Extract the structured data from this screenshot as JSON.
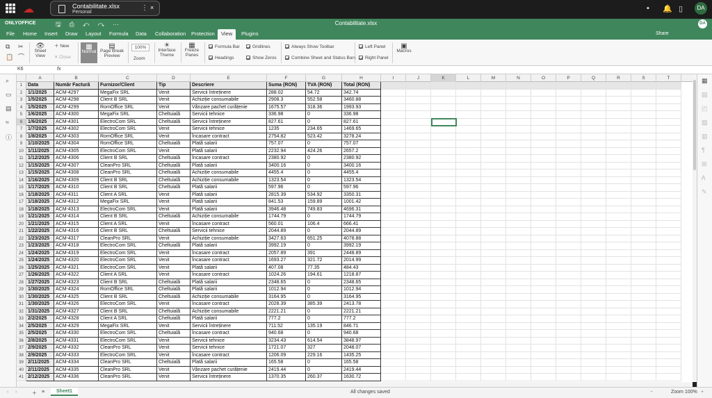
{
  "topbar": {
    "file_name": "Contabilitate.xlsx",
    "location": "Personal",
    "more": "⋮",
    "close": "×",
    "avatar": "DA"
  },
  "header": {
    "logo": "ONLYOFFICE",
    "title": "Contabilitate.xlsx",
    "avatar": "DA",
    "share": "Share"
  },
  "menu": [
    "File",
    "Home",
    "Insert",
    "Draw",
    "Layout",
    "Formula",
    "Data",
    "Collaboration",
    "Protection",
    "View",
    "Plugins"
  ],
  "menu_active": "View",
  "toolbar": {
    "sheet_view": "Sheet View",
    "new": "New",
    "close": "Close",
    "normal": "Normal",
    "page_break": "Page Break Preview",
    "zoom_value": "100%",
    "zoom": "Zoom",
    "interface_theme": "Interface Theme",
    "freeze_panes": "Freeze Panes",
    "formula_bar": "Formula Bar",
    "headings": "Headings",
    "gridlines": "Gridlines",
    "show_zeros": "Show Zeros",
    "always_show_toolbar": "Always Show Toolbar",
    "combine_sheet": "Combine Sheet and Status Bars",
    "left_panel": "Left Panel",
    "right_panel": "Right Panel",
    "macros": "Macros"
  },
  "formula": {
    "name_box": "K6",
    "fx": "fx",
    "value": ""
  },
  "columns": [
    "A",
    "B",
    "C",
    "D",
    "E",
    "F",
    "G",
    "H",
    "I",
    "J",
    "K",
    "L",
    "M",
    "N",
    "O",
    "P",
    "Q",
    "R",
    "S",
    "T"
  ],
  "table_header": [
    "Data",
    "Număr Factură",
    "Furnizor/Client",
    "Tip",
    "Descriere",
    "Suma (RON)",
    "TVA (RON)",
    "Total (RON)"
  ],
  "rows": [
    [
      "1/1/2025",
      "ACM-4297",
      "MegaFix SRL",
      "Venit",
      "Servicii întreținere",
      "288.02",
      "54.72",
      "342.74"
    ],
    [
      "1/5/2025",
      "ACM-4298",
      "Client B SRL",
      "Venit",
      "Achiziție consumabile",
      "2908.3",
      "552.58",
      "3460.88"
    ],
    [
      "1/5/2025",
      "ACM-4299",
      "RomOffice SRL",
      "Venit",
      "Vânzare pachet curățenie",
      "1675.57",
      "318.36",
      "1993.93"
    ],
    [
      "1/6/2025",
      "ACM-4300",
      "MegaFix SRL",
      "Cheltuială",
      "Servicii tehnice",
      "336.98",
      "0",
      "336.98"
    ],
    [
      "1/6/2025",
      "ACM-4301",
      "ElectroCom SRL",
      "Cheltuială",
      "Servicii întreținere",
      "827.61",
      "0",
      "827.61"
    ],
    [
      "1/7/2025",
      "ACM-4302",
      "ElectroCom SRL",
      "Venit",
      "Servicii tehnice",
      "1235",
      "234.65",
      "1469.65"
    ],
    [
      "1/8/2025",
      "ACM-4303",
      "RomOffice SRL",
      "Venit",
      "Încasare contract",
      "2754.82",
      "523.42",
      "3278.24"
    ],
    [
      "1/10/2025",
      "ACM-4304",
      "RomOffice SRL",
      "Cheltuială",
      "Plată salarii",
      "757.07",
      "0",
      "757.07"
    ],
    [
      "1/11/2025",
      "ACM-4305",
      "ElectroCom SRL",
      "Venit",
      "Plată salarii",
      "2232.94",
      "424.26",
      "2657.2"
    ],
    [
      "1/12/2025",
      "ACM-4306",
      "Client B SRL",
      "Cheltuială",
      "Încasare contract",
      "2380.92",
      "0",
      "2380.92"
    ],
    [
      "1/15/2025",
      "ACM-4307",
      "CleanPro SRL",
      "Cheltuială",
      "Plată salarii",
      "3400.16",
      "0",
      "3400.16"
    ],
    [
      "1/15/2025",
      "ACM-4308",
      "CleanPro SRL",
      "Cheltuială",
      "Achiziție consumabile",
      "4455.4",
      "0",
      "4455.4"
    ],
    [
      "1/16/2025",
      "ACM-4309",
      "Client B SRL",
      "Cheltuială",
      "Achiziție consumabile",
      "1323.54",
      "0",
      "1323.54"
    ],
    [
      "1/17/2025",
      "ACM-4310",
      "Client B SRL",
      "Cheltuială",
      "Plată salarii",
      "597.96",
      "0",
      "597.96"
    ],
    [
      "1/18/2025",
      "ACM-4311",
      "Client A SRL",
      "Venit",
      "Plată salarii",
      "2815.39",
      "534.92",
      "3350.31"
    ],
    [
      "1/18/2025",
      "ACM-4312",
      "MegaFix SRL",
      "Venit",
      "Plată salarii",
      "841.53",
      "159.89",
      "1001.42"
    ],
    [
      "1/18/2025",
      "ACM-4313",
      "ElectroCom SRL",
      "Venit",
      "Plată salarii",
      "3946.48",
      "749.83",
      "4696.31"
    ],
    [
      "1/21/2025",
      "ACM-4314",
      "Client B SRL",
      "Cheltuială",
      "Achiziție consumabile",
      "1744.79",
      "0",
      "1744.79"
    ],
    [
      "1/21/2025",
      "ACM-4315",
      "Client A SRL",
      "Venit",
      "Încasare contract",
      "560.01",
      "106.4",
      "666.41"
    ],
    [
      "1/22/2025",
      "ACM-4316",
      "Client B SRL",
      "Cheltuială",
      "Servicii tehnice",
      "2044.89",
      "0",
      "2044.89"
    ],
    [
      "1/23/2025",
      "ACM-4317",
      "CleanPro SRL",
      "Venit",
      "Achiziție consumabile",
      "3427.63",
      "651.25",
      "4078.88"
    ],
    [
      "1/23/2025",
      "ACM-4318",
      "ElectroCom SRL",
      "Cheltuială",
      "Plată salarii",
      "3992.19",
      "0",
      "3992.19"
    ],
    [
      "1/24/2025",
      "ACM-4319",
      "ElectroCom SRL",
      "Venit",
      "Încasare contract",
      "2057.89",
      "391",
      "2448.89"
    ],
    [
      "1/24/2025",
      "ACM-4320",
      "ElectroCom SRL",
      "Venit",
      "Încasare contract",
      "1693.27",
      "321.72",
      "2014.99"
    ],
    [
      "1/25/2025",
      "ACM-4321",
      "ElectroCom SRL",
      "Venit",
      "Plată salarii",
      "407.08",
      "77.35",
      "484.43"
    ],
    [
      "1/26/2025",
      "ACM-4322",
      "Client A SRL",
      "Venit",
      "Încasare contract",
      "1024.26",
      "194.61",
      "1218.87"
    ],
    [
      "1/27/2025",
      "ACM-4323",
      "Client B SRL",
      "Cheltuială",
      "Plată salarii",
      "2348.65",
      "0",
      "2348.65"
    ],
    [
      "1/30/2025",
      "ACM-4324",
      "RomOffice SRL",
      "Cheltuială",
      "Plată salarii",
      "1012.94",
      "0",
      "1012.94"
    ],
    [
      "1/30/2025",
      "ACM-4325",
      "Client B SRL",
      "Cheltuială",
      "Achiziție consumabile",
      "3164.95",
      "0",
      "3164.95"
    ],
    [
      "1/30/2025",
      "ACM-4326",
      "ElectroCom SRL",
      "Venit",
      "Încasare contract",
      "2028.39",
      "385.39",
      "2413.78"
    ],
    [
      "1/31/2025",
      "ACM-4327",
      "Client B SRL",
      "Cheltuială",
      "Achiziție consumabile",
      "2221.21",
      "0",
      "2221.21"
    ],
    [
      "2/2/2025",
      "ACM-4328",
      "Client A SRL",
      "Cheltuială",
      "Plată salarii",
      "777.2",
      "0",
      "777.2"
    ],
    [
      "2/5/2025",
      "ACM-4329",
      "MegaFix SRL",
      "Venit",
      "Servicii întreținere",
      "711.52",
      "135.19",
      "846.71"
    ],
    [
      "2/5/2025",
      "ACM-4330",
      "ElectroCom SRL",
      "Cheltuială",
      "Încasare contract",
      "940.68",
      "0",
      "940.68"
    ],
    [
      "2/8/2025",
      "ACM-4331",
      "ElectroCom SRL",
      "Venit",
      "Servicii tehnice",
      "3234.43",
      "614.54",
      "3848.97"
    ],
    [
      "2/9/2025",
      "ACM-4332",
      "CleanPro SRL",
      "Venit",
      "Servicii tehnice",
      "1721.07",
      "327",
      "2048.07"
    ],
    [
      "2/9/2025",
      "ACM-4333",
      "ElectroCom SRL",
      "Venit",
      "Încasare contract",
      "1206.09",
      "229.16",
      "1435.25"
    ],
    [
      "2/11/2025",
      "ACM-4334",
      "CleanPro SRL",
      "Cheltuială",
      "Plată salarii",
      "165.58",
      "0",
      "165.58"
    ],
    [
      "2/11/2025",
      "ACM-4335",
      "CleanPro SRL",
      "Venit",
      "Vânzare pachet curățenie",
      "2419.44",
      "0",
      "2419.44"
    ],
    [
      "2/12/2025",
      "ACM-4336",
      "CleanPro SRL",
      "Venit",
      "Servicii întreținere",
      "1370.35",
      "260.37",
      "1630.72"
    ]
  ],
  "status": {
    "saved": "All changes saved",
    "zoom": "Zoom 100%",
    "sheet": "Sheet1"
  }
}
